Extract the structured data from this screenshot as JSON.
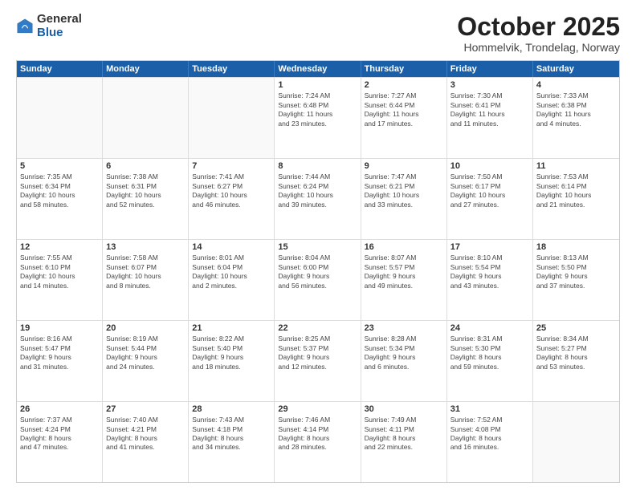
{
  "logo": {
    "general": "General",
    "blue": "Blue"
  },
  "title": "October 2025",
  "location": "Hommelvik, Trondelag, Norway",
  "days_of_week": [
    "Sunday",
    "Monday",
    "Tuesday",
    "Wednesday",
    "Thursday",
    "Friday",
    "Saturday"
  ],
  "weeks": [
    [
      {
        "day": "",
        "text": "",
        "empty": true
      },
      {
        "day": "",
        "text": "",
        "empty": true
      },
      {
        "day": "",
        "text": "",
        "empty": true
      },
      {
        "day": "1",
        "text": "Sunrise: 7:24 AM\nSunset: 6:48 PM\nDaylight: 11 hours\nand 23 minutes.",
        "empty": false
      },
      {
        "day": "2",
        "text": "Sunrise: 7:27 AM\nSunset: 6:44 PM\nDaylight: 11 hours\nand 17 minutes.",
        "empty": false
      },
      {
        "day": "3",
        "text": "Sunrise: 7:30 AM\nSunset: 6:41 PM\nDaylight: 11 hours\nand 11 minutes.",
        "empty": false
      },
      {
        "day": "4",
        "text": "Sunrise: 7:33 AM\nSunset: 6:38 PM\nDaylight: 11 hours\nand 4 minutes.",
        "empty": false
      }
    ],
    [
      {
        "day": "5",
        "text": "Sunrise: 7:35 AM\nSunset: 6:34 PM\nDaylight: 10 hours\nand 58 minutes.",
        "empty": false
      },
      {
        "day": "6",
        "text": "Sunrise: 7:38 AM\nSunset: 6:31 PM\nDaylight: 10 hours\nand 52 minutes.",
        "empty": false
      },
      {
        "day": "7",
        "text": "Sunrise: 7:41 AM\nSunset: 6:27 PM\nDaylight: 10 hours\nand 46 minutes.",
        "empty": false
      },
      {
        "day": "8",
        "text": "Sunrise: 7:44 AM\nSunset: 6:24 PM\nDaylight: 10 hours\nand 39 minutes.",
        "empty": false
      },
      {
        "day": "9",
        "text": "Sunrise: 7:47 AM\nSunset: 6:21 PM\nDaylight: 10 hours\nand 33 minutes.",
        "empty": false
      },
      {
        "day": "10",
        "text": "Sunrise: 7:50 AM\nSunset: 6:17 PM\nDaylight: 10 hours\nand 27 minutes.",
        "empty": false
      },
      {
        "day": "11",
        "text": "Sunrise: 7:53 AM\nSunset: 6:14 PM\nDaylight: 10 hours\nand 21 minutes.",
        "empty": false
      }
    ],
    [
      {
        "day": "12",
        "text": "Sunrise: 7:55 AM\nSunset: 6:10 PM\nDaylight: 10 hours\nand 14 minutes.",
        "empty": false
      },
      {
        "day": "13",
        "text": "Sunrise: 7:58 AM\nSunset: 6:07 PM\nDaylight: 10 hours\nand 8 minutes.",
        "empty": false
      },
      {
        "day": "14",
        "text": "Sunrise: 8:01 AM\nSunset: 6:04 PM\nDaylight: 10 hours\nand 2 minutes.",
        "empty": false
      },
      {
        "day": "15",
        "text": "Sunrise: 8:04 AM\nSunset: 6:00 PM\nDaylight: 9 hours\nand 56 minutes.",
        "empty": false
      },
      {
        "day": "16",
        "text": "Sunrise: 8:07 AM\nSunset: 5:57 PM\nDaylight: 9 hours\nand 49 minutes.",
        "empty": false
      },
      {
        "day": "17",
        "text": "Sunrise: 8:10 AM\nSunset: 5:54 PM\nDaylight: 9 hours\nand 43 minutes.",
        "empty": false
      },
      {
        "day": "18",
        "text": "Sunrise: 8:13 AM\nSunset: 5:50 PM\nDaylight: 9 hours\nand 37 minutes.",
        "empty": false
      }
    ],
    [
      {
        "day": "19",
        "text": "Sunrise: 8:16 AM\nSunset: 5:47 PM\nDaylight: 9 hours\nand 31 minutes.",
        "empty": false
      },
      {
        "day": "20",
        "text": "Sunrise: 8:19 AM\nSunset: 5:44 PM\nDaylight: 9 hours\nand 24 minutes.",
        "empty": false
      },
      {
        "day": "21",
        "text": "Sunrise: 8:22 AM\nSunset: 5:40 PM\nDaylight: 9 hours\nand 18 minutes.",
        "empty": false
      },
      {
        "day": "22",
        "text": "Sunrise: 8:25 AM\nSunset: 5:37 PM\nDaylight: 9 hours\nand 12 minutes.",
        "empty": false
      },
      {
        "day": "23",
        "text": "Sunrise: 8:28 AM\nSunset: 5:34 PM\nDaylight: 9 hours\nand 6 minutes.",
        "empty": false
      },
      {
        "day": "24",
        "text": "Sunrise: 8:31 AM\nSunset: 5:30 PM\nDaylight: 8 hours\nand 59 minutes.",
        "empty": false
      },
      {
        "day": "25",
        "text": "Sunrise: 8:34 AM\nSunset: 5:27 PM\nDaylight: 8 hours\nand 53 minutes.",
        "empty": false
      }
    ],
    [
      {
        "day": "26",
        "text": "Sunrise: 7:37 AM\nSunset: 4:24 PM\nDaylight: 8 hours\nand 47 minutes.",
        "empty": false
      },
      {
        "day": "27",
        "text": "Sunrise: 7:40 AM\nSunset: 4:21 PM\nDaylight: 8 hours\nand 41 minutes.",
        "empty": false
      },
      {
        "day": "28",
        "text": "Sunrise: 7:43 AM\nSunset: 4:18 PM\nDaylight: 8 hours\nand 34 minutes.",
        "empty": false
      },
      {
        "day": "29",
        "text": "Sunrise: 7:46 AM\nSunset: 4:14 PM\nDaylight: 8 hours\nand 28 minutes.",
        "empty": false
      },
      {
        "day": "30",
        "text": "Sunrise: 7:49 AM\nSunset: 4:11 PM\nDaylight: 8 hours\nand 22 minutes.",
        "empty": false
      },
      {
        "day": "31",
        "text": "Sunrise: 7:52 AM\nSunset: 4:08 PM\nDaylight: 8 hours\nand 16 minutes.",
        "empty": false
      },
      {
        "day": "",
        "text": "",
        "empty": true
      }
    ]
  ]
}
